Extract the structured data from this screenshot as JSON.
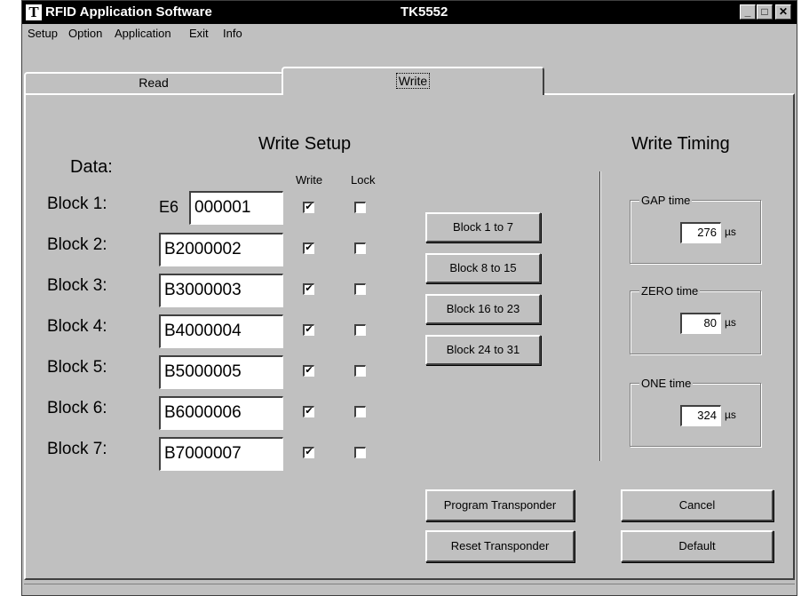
{
  "window": {
    "title": "RFID Application Software",
    "model": "TK5552",
    "icon_letter": "T",
    "minimize": "_",
    "maximize": "□",
    "close": "✕"
  },
  "menu": [
    "Setup",
    "Option",
    "Application",
    "Exit",
    "Info"
  ],
  "tabs": {
    "read": "Read",
    "write": "Write",
    "active": "Write"
  },
  "write_setup": {
    "heading": "Write Setup",
    "data_label": "Data:",
    "col_write": "Write",
    "col_lock": "Lock",
    "block1_prefix": "E6",
    "blocks": [
      {
        "label": "Block 1:",
        "value": "000001",
        "write": true,
        "lock": false
      },
      {
        "label": "Block 2:",
        "value": "B2000002",
        "write": true,
        "lock": false
      },
      {
        "label": "Block 3:",
        "value": "B3000003",
        "write": true,
        "lock": false
      },
      {
        "label": "Block 4:",
        "value": "B4000004",
        "write": true,
        "lock": false
      },
      {
        "label": "Block 5:",
        "value": "B5000005",
        "write": true,
        "lock": false
      },
      {
        "label": "Block 6:",
        "value": "B6000006",
        "write": true,
        "lock": false
      },
      {
        "label": "Block 7:",
        "value": "B7000007",
        "write": true,
        "lock": false
      }
    ],
    "range_buttons": [
      "Block 1 to 7",
      "Block 8 to 15",
      "Block 16 to 23",
      "Block 24 to 31"
    ]
  },
  "write_timing": {
    "heading": "Write Timing",
    "gap": {
      "label": "GAP time",
      "value": "276",
      "unit": "µs"
    },
    "zero": {
      "label": "ZERO time",
      "value": "80",
      "unit": "µs"
    },
    "one": {
      "label": "ONE time",
      "value": "324",
      "unit": "µs"
    }
  },
  "buttons": {
    "program": "Program Transponder",
    "reset": "Reset Transponder",
    "cancel": "Cancel",
    "default": "Default"
  },
  "check_mark": "✔"
}
